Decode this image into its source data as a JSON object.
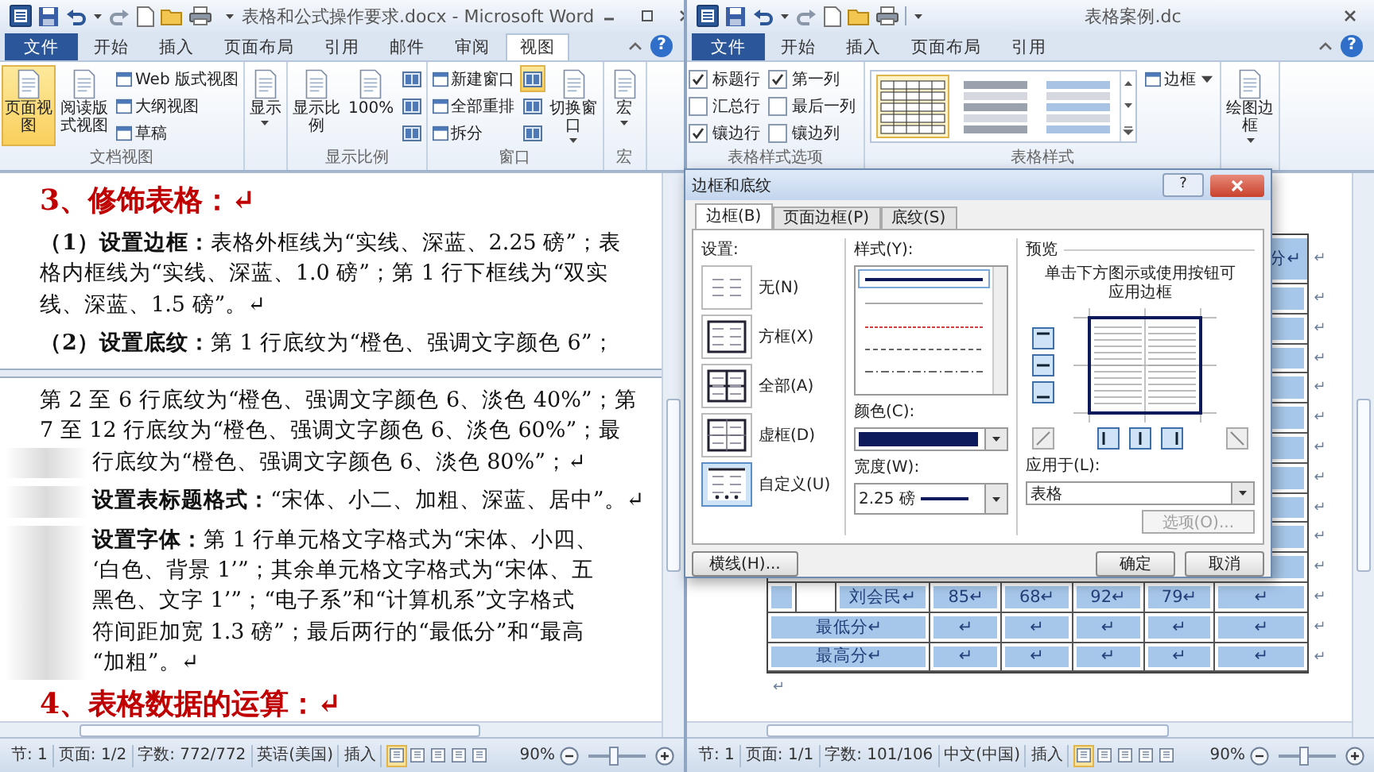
{
  "windows": [
    {
      "title": "表格和公式操作要求.docx - Microsoft Word",
      "window_buttons": [
        {
          "kind": "minimize"
        },
        {
          "kind": "maximize"
        },
        {
          "kind": "close"
        }
      ],
      "tabs": [
        {
          "label": "文件",
          "kind": "file",
          "selected": false
        },
        {
          "label": "开始",
          "kind": "tab",
          "selected": false
        },
        {
          "label": "插入",
          "kind": "tab",
          "selected": false
        },
        {
          "label": "页面布局",
          "kind": "tab",
          "selected": false
        },
        {
          "label": "引用",
          "kind": "tab",
          "selected": false
        },
        {
          "label": "邮件",
          "kind": "tab",
          "selected": false
        },
        {
          "label": "审阅",
          "kind": "tab",
          "selected": false
        },
        {
          "label": "视图",
          "kind": "tab",
          "selected": true
        }
      ],
      "help": "?",
      "ribbon": [
        {
          "label": "文档视图",
          "items": [
            {
              "kind": "large",
              "label": "页面视图",
              "selected": true
            },
            {
              "kind": "large",
              "label": "阅读版式视图",
              "selected": false
            },
            {
              "kind": "small",
              "label": "Web 版式视图",
              "selected": false
            },
            {
              "kind": "small",
              "label": "大纲视图",
              "selected": false
            },
            {
              "kind": "small",
              "label": "草稿",
              "selected": false
            }
          ]
        },
        {
          "items": [
            {
              "kind": "large",
              "label": "显示",
              "selected": false,
              "dropdown": true
            }
          ]
        },
        {
          "label": "显示比例",
          "items": [
            {
              "kind": "large",
              "label": "显示比例",
              "selected": false
            },
            {
              "kind": "large",
              "label": "100%",
              "selected": false
            },
            {
              "kind": "small_icon",
              "selected": false
            },
            {
              "kind": "small_icon",
              "selected": false
            },
            {
              "kind": "small_icon",
              "selected": false
            }
          ]
        },
        {
          "label": "窗口",
          "items": [
            {
              "kind": "small",
              "label": "新建窗口",
              "selected": false
            },
            {
              "kind": "small",
              "label": "全部重排",
              "selected": false
            },
            {
              "kind": "small",
              "label": "拆分",
              "selected": false
            },
            {
              "kind": "small_icon",
              "selected": true
            },
            {
              "kind": "small_icon",
              "selected": false
            },
            {
              "kind": "small_icon",
              "selected": false
            },
            {
              "kind": "large",
              "label": "切换窗口",
              "selected": false,
              "dropdown": true
            }
          ]
        },
        {
          "label": "宏",
          "items": [
            {
              "kind": "large",
              "label": "宏",
              "selected": false,
              "dropdown": true
            }
          ]
        }
      ],
      "document": {
        "kind": "text",
        "panes": [
          [
            {
              "kind": "heading",
              "text": "3、修饰表格：↵"
            },
            {
              "kind": "para",
              "covered": false,
              "lines": [
                "**（1）设置边框：**表格外框线为“实线、深蓝、2.25 磅”；表",
                "格内框线为“实线、深蓝、1.0 磅”；第 1 行下框线为“双实",
                "线、深蓝、1.5 磅”。↵"
              ]
            },
            {
              "kind": "para",
              "covered": false,
              "lines": [
                "**（2）设置底纹：**第 1 行底纹为“橙色、强调文字颜色 6”；"
              ]
            }
          ],
          [
            {
              "kind": "para",
              "covered": false,
              "lines": [
                "第 2 至 6 行底纹为“橙色、强调文字颜色 6、淡色 40%”；第",
                "7 至 12 行底纹为“橙色、强调文字颜色 6、淡色 60%”；最"
              ]
            },
            {
              "kind": "cont",
              "covered": true,
              "lines": [
                "行底纹为“橙色、强调文字颜色 6、淡色 80%”；↵"
              ]
            },
            {
              "kind": "para",
              "covered": true,
              "lines": [
                "**设置表标题格式：**“宋体、小二、加粗、深蓝、居中”。↵"
              ]
            },
            {
              "kind": "para",
              "covered": true,
              "lines": [
                "**设置字体：**第 1 行单元格文字格式为“宋体、小四、",
                "‘白色、背景 1’”；其余单元格文字格式为“宋体、五",
                "黑色、文字 1’”；“电子系”和“计算机系”文字格式",
                "符间距加宽 1.3 磅”；最后两行的“最低分”和“最高",
                "“加粗”。↵"
              ]
            },
            {
              "kind": "heading",
              "text": "4、表格数据的运算：↵"
            }
          ]
        ]
      },
      "status_bar": {
        "items": [
          "节: 1",
          "页面: 1/2",
          "字数: 772/772",
          "英语(美国)",
          "插入"
        ],
        "views": [
          {
            "selected": true
          },
          {
            "selected": false
          },
          {
            "selected": false
          },
          {
            "selected": false
          },
          {
            "selected": false
          }
        ],
        "zoom": "90%",
        "level": 0.45
      }
    },
    {
      "title": "表格案例.dc",
      "window_buttons": [
        {
          "kind": "close"
        }
      ],
      "tabs": [
        {
          "label": "文件",
          "kind": "file",
          "selected": false
        },
        {
          "label": "开始",
          "kind": "tab",
          "selected": false
        },
        {
          "label": "插入",
          "kind": "tab",
          "selected": false
        },
        {
          "label": "页面布局",
          "kind": "tab",
          "selected": false
        },
        {
          "label": "引用",
          "kind": "tab",
          "selected": false
        }
      ],
      "help": "?",
      "ribbon": [
        {
          "label": "表格样式选项",
          "items": [
            {
              "kind": "check",
              "label": "标题行",
              "checked": true
            },
            {
              "kind": "check",
              "label": "汇总行",
              "checked": false
            },
            {
              "kind": "check",
              "label": "镶边行",
              "checked": true
            },
            {
              "kind": "check",
              "label": "第一列",
              "checked": true
            },
            {
              "kind": "check",
              "label": "最后一列",
              "checked": false
            },
            {
              "kind": "check",
              "label": "镶边列",
              "checked": false
            }
          ]
        },
        {
          "label": "表格样式",
          "items": [
            {
              "kind": "gallery",
              "styles": [
                {
                  "selected": true
                },
                {
                  "selected": false
                },
                {
                  "selected": false
                }
              ]
            },
            {
              "kind": "small",
              "label": "边框",
              "selected": false,
              "dropdown": true
            }
          ]
        },
        {
          "items": [
            {
              "kind": "large",
              "label": "绘图边框",
              "selected": false,
              "dropdown": true
            }
          ]
        }
      ],
      "document": {
        "kind": "table",
        "rows": [
          {
            "kind": "header",
            "tail": "分↵",
            "end": "↵"
          },
          {
            "kind": "hidden",
            "end": "↵"
          },
          {
            "kind": "hidden",
            "end": "↵"
          },
          {
            "kind": "hidden",
            "end": "↵"
          },
          {
            "kind": "hidden",
            "end": "↵"
          },
          {
            "kind": "hidden",
            "end": "↵"
          },
          {
            "kind": "hidden",
            "end": "↵"
          },
          {
            "kind": "hidden",
            "end": "↵"
          },
          {
            "kind": "hidden",
            "end": "↵"
          },
          {
            "kind": "hidden",
            "end": "↵"
          },
          {
            "kind": "hidden",
            "end": "↵"
          },
          {
            "kind": "data",
            "cells": [
              "刘会民↵",
              "85↵",
              "68↵",
              "92↵",
              "79↵",
              "↵"
            ],
            "end": "↵"
          },
          {
            "kind": "summary",
            "cells": [
              "最低分↵",
              "↵",
              "↵",
              "↵",
              "↵",
              "↵"
            ],
            "end": "↵"
          },
          {
            "kind": "summary",
            "cells": [
              "最高分↵",
              "↵",
              "↵",
              "↵",
              "↵",
              "↵"
            ],
            "end": "↵"
          }
        ],
        "after": "↵"
      },
      "status_bar": {
        "items": [
          "节: 1",
          "页面: 1/1",
          "字数: 101/106",
          "中文(中国)",
          "插入"
        ],
        "views": [
          {
            "selected": true
          },
          {
            "selected": false
          },
          {
            "selected": false
          },
          {
            "selected": false
          },
          {
            "selected": false
          }
        ],
        "zoom": "90%",
        "level": 0.45
      }
    }
  ],
  "dialog": {
    "title": "边框和底纹",
    "help": "?",
    "tabs": [
      {
        "label": "边框(B)",
        "selected": true
      },
      {
        "label": "页面边框(P)",
        "selected": false
      },
      {
        "label": "底纹(S)",
        "selected": false
      }
    ],
    "settings": {
      "label": "设置:",
      "options": [
        {
          "label": "无(N)",
          "kind": "none",
          "selected": false
        },
        {
          "label": "方框(X)",
          "kind": "box",
          "selected": false
        },
        {
          "label": "全部(A)",
          "kind": "all",
          "selected": false
        },
        {
          "label": "虚框(D)",
          "kind": "grid",
          "selected": false
        },
        {
          "label": "自定义(U)",
          "kind": "custom",
          "selected": true
        }
      ]
    },
    "style": {
      "label": "样式(Y):"
    },
    "color": {
      "label": "颜色(C):"
    },
    "width": {
      "label": "宽度(W):",
      "value": "2.25 磅"
    },
    "preview": {
      "label": "预览",
      "hint": "单击下方图示或使用按钮可应用边框"
    },
    "apply": {
      "label": "应用于(L):",
      "value": "表格"
    },
    "options_button": {
      "label": "选项(O)...",
      "disabled": true
    },
    "buttons": [
      {
        "label": "横线(H)...",
        "kind": "horizontal_line"
      },
      {
        "label": "确定",
        "kind": "ok"
      },
      {
        "label": "取消",
        "kind": "cancel"
      }
    ]
  }
}
